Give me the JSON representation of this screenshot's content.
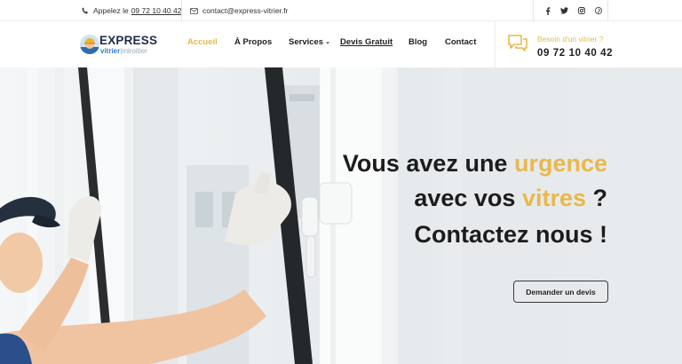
{
  "topbar": {
    "phone_prefix": "Appelez le",
    "phone": "09 72 10 40 42",
    "email": "contact@express-vitrier.fr",
    "social_icons": [
      "facebook-icon",
      "twitter-icon",
      "instagram-icon",
      "pinterest-icon"
    ]
  },
  "logo": {
    "title": "EXPRESS",
    "sub_primary": "vitrier",
    "sub_secondary": "miroitier"
  },
  "nav": {
    "items": [
      {
        "label": "Accueil",
        "active": true
      },
      {
        "label": "À Propos"
      },
      {
        "label": "Services",
        "dropdown": true
      },
      {
        "label": "Devis Gratuit"
      },
      {
        "label": "Blog"
      },
      {
        "label": "Contact"
      }
    ]
  },
  "cta": {
    "label": "Besoin d'un vitrier ?",
    "phone": "09 72 10 40 42",
    "icon": "chat-bubbles-icon"
  },
  "hero": {
    "line1_a": "Vous avez une ",
    "line1_hl": "urgence",
    "line2_a": "avec vos ",
    "line2_hl": "vitres",
    "line2_b": " ?",
    "line3": "Contactez nous !",
    "button": "Demander un devis"
  },
  "colors": {
    "accent": "#e9b84d",
    "dark": "#1c1c1c",
    "logo_blue": "#2c7fd1",
    "logo_navy": "#1f2b4d"
  }
}
